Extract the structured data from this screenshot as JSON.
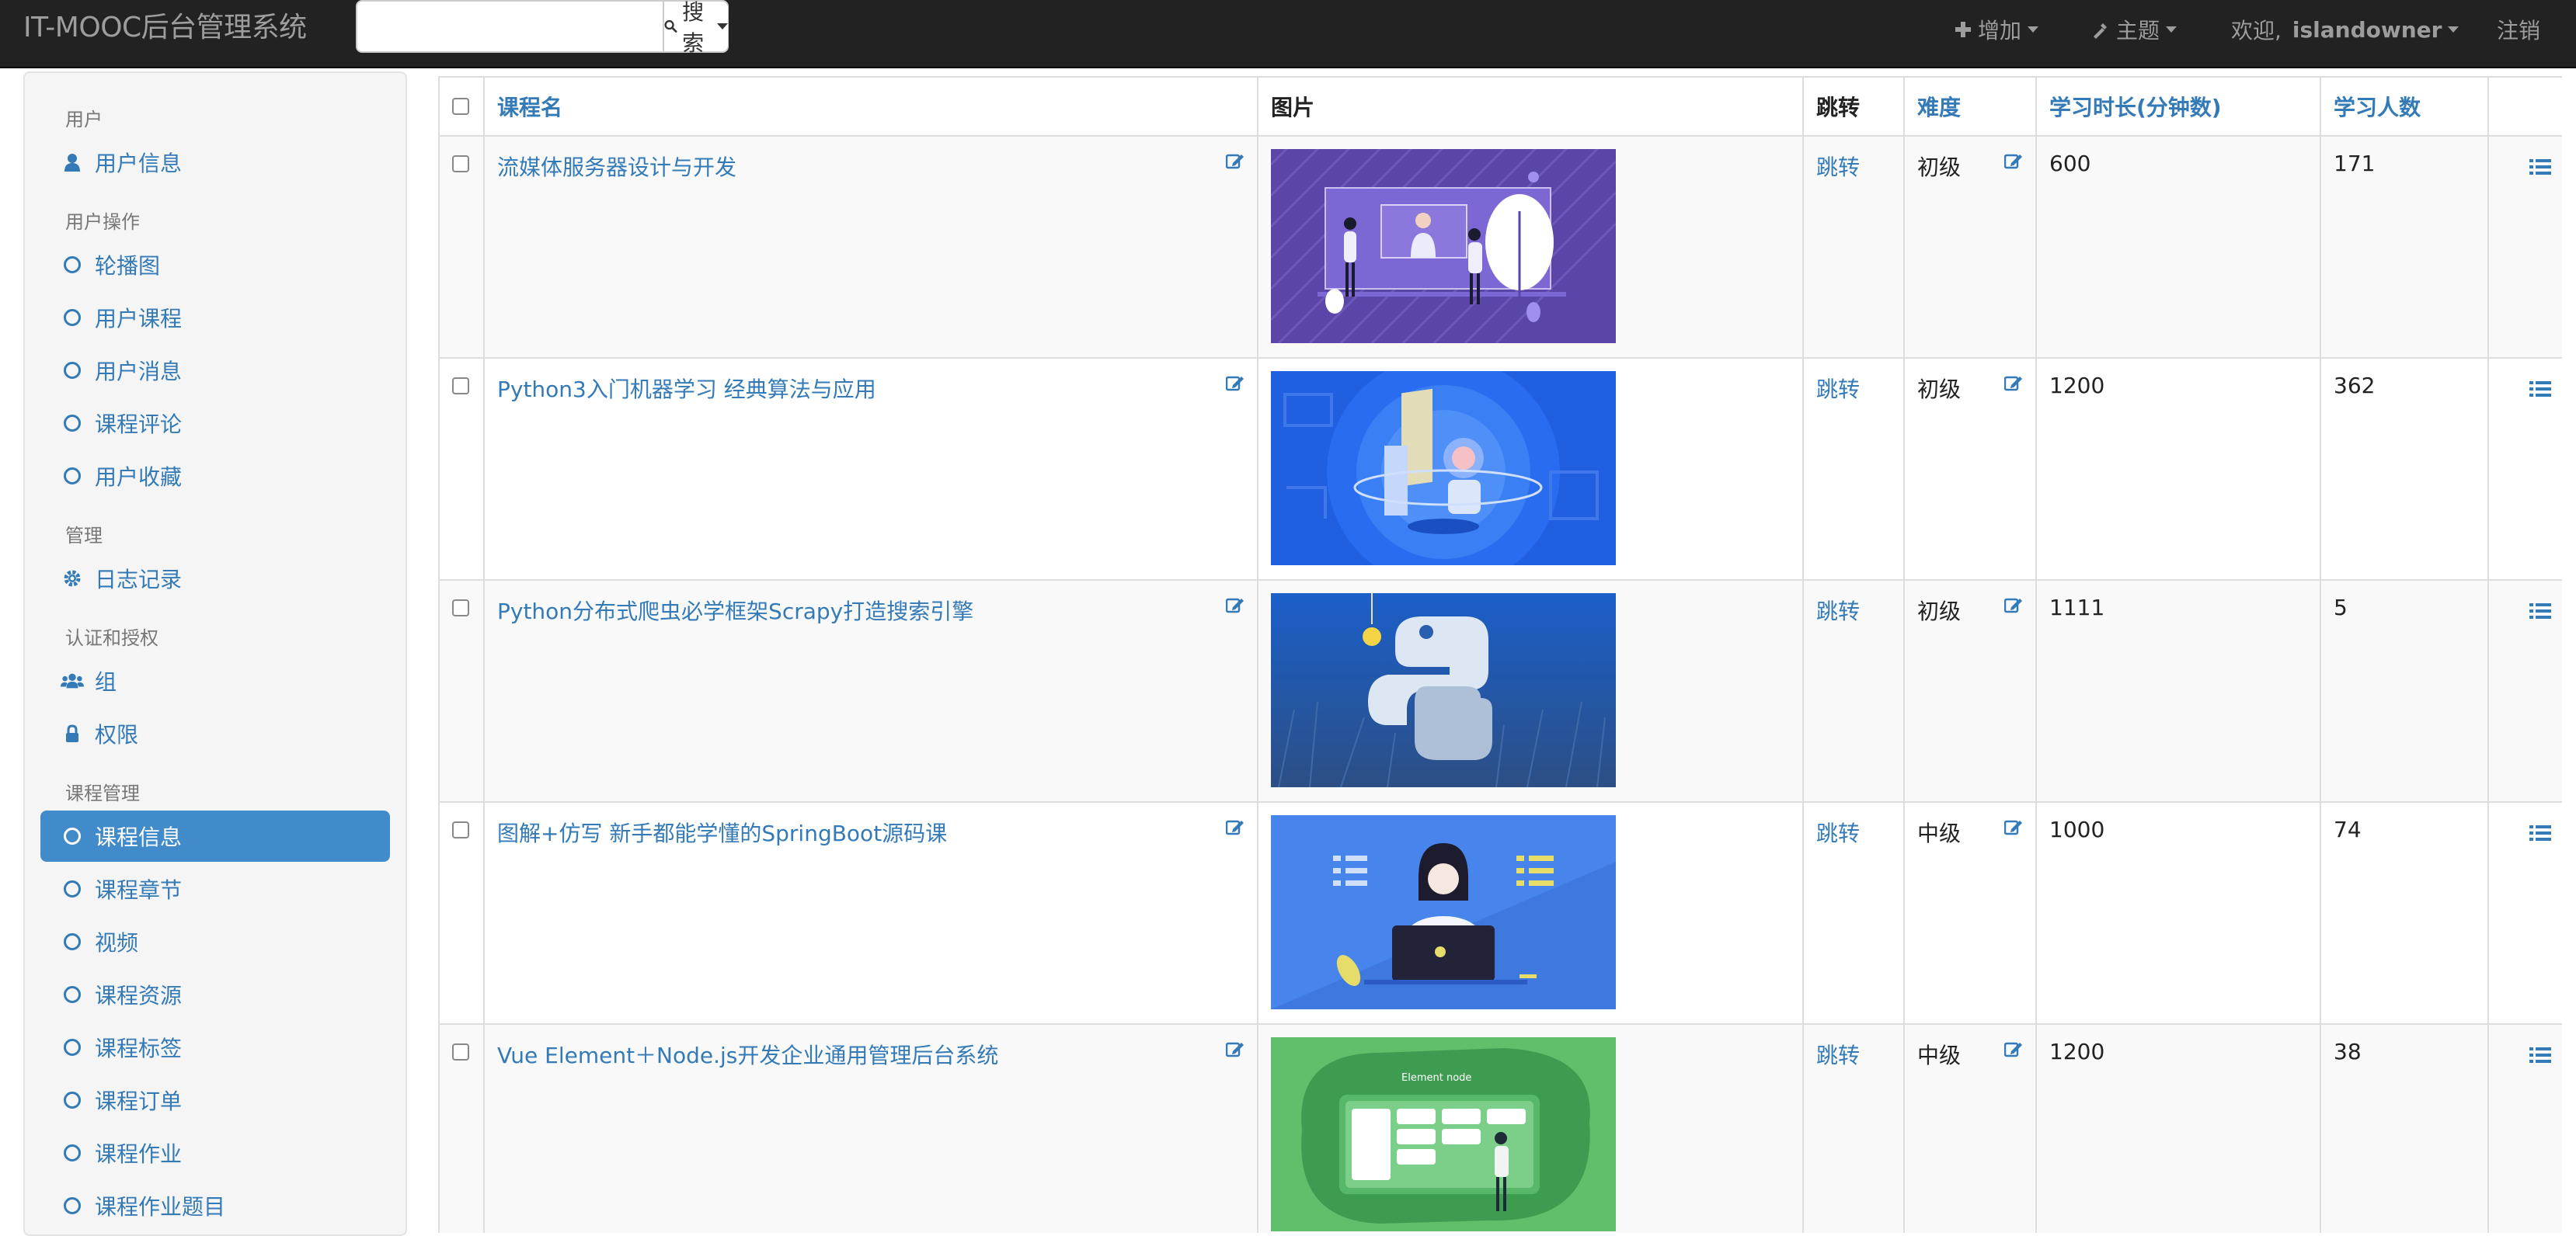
{
  "header": {
    "brand": "IT-MOOC后台管理系统",
    "search_placeholder": "",
    "search_label": "搜索",
    "add_label": "增加",
    "theme_label": "主题",
    "welcome_label": "欢迎,",
    "username": "islandowner",
    "logout_label": "注销"
  },
  "sidebar": {
    "sections": [
      {
        "title": "用户",
        "items": [
          {
            "label": "用户信息",
            "icon": "user-icon"
          }
        ]
      },
      {
        "title": "用户操作",
        "items": [
          {
            "label": "轮播图",
            "icon": "circle-icon"
          },
          {
            "label": "用户课程",
            "icon": "circle-icon"
          },
          {
            "label": "用户消息",
            "icon": "circle-icon"
          },
          {
            "label": "课程评论",
            "icon": "circle-icon"
          },
          {
            "label": "用户收藏",
            "icon": "circle-icon"
          }
        ]
      },
      {
        "title": "管理",
        "items": [
          {
            "label": "日志记录",
            "icon": "gear-icon"
          }
        ]
      },
      {
        "title": "认证和授权",
        "items": [
          {
            "label": "组",
            "icon": "users-icon"
          },
          {
            "label": "权限",
            "icon": "lock-icon"
          }
        ]
      },
      {
        "title": "课程管理",
        "items": [
          {
            "label": "课程信息",
            "icon": "circle-icon",
            "active": true
          },
          {
            "label": "课程章节",
            "icon": "circle-icon"
          },
          {
            "label": "视频",
            "icon": "circle-icon"
          },
          {
            "label": "课程资源",
            "icon": "circle-icon"
          },
          {
            "label": "课程标签",
            "icon": "circle-icon"
          },
          {
            "label": "课程订单",
            "icon": "circle-icon"
          },
          {
            "label": "课程作业",
            "icon": "circle-icon"
          },
          {
            "label": "课程作业题目",
            "icon": "circle-icon"
          }
        ]
      }
    ]
  },
  "table": {
    "headers": {
      "name": "课程名",
      "image": "图片",
      "jump": "跳转",
      "difficulty": "难度",
      "duration": "学习时长(分钟数)",
      "students": "学习人数"
    },
    "rows": [
      {
        "name": "流媒体服务器设计与开发",
        "jump": "跳转",
        "difficulty": "初级",
        "duration": "600",
        "students": "171",
        "image_theme": "purple-illustration"
      },
      {
        "name": "Python3入门机器学习 经典算法与应用",
        "jump": "跳转",
        "difficulty": "初级",
        "duration": "1200",
        "students": "362",
        "image_theme": "blue-python-robot"
      },
      {
        "name": "Python分布式爬虫必学框架Scrapy打造搜索引擎",
        "jump": "跳转",
        "difficulty": "初级",
        "duration": "1111",
        "students": "5",
        "image_theme": "python-logo-grass"
      },
      {
        "name": "图解+仿写 新手都能学懂的SpringBoot源码课",
        "jump": "跳转",
        "difficulty": "中级",
        "duration": "1000",
        "students": "74",
        "image_theme": "blue-laptop-girl"
      },
      {
        "name": "Vue Element＋Node.js开发企业通用管理后台系统",
        "jump": "跳转",
        "difficulty": "中级",
        "duration": "1200",
        "students": "38",
        "image_theme": "green-element-node",
        "image_text": "Element node"
      }
    ]
  },
  "colors": {
    "topbar": "#222222",
    "link": "#337ab7",
    "active": "#428bca",
    "sidebar_bg": "#f5f5f5"
  }
}
